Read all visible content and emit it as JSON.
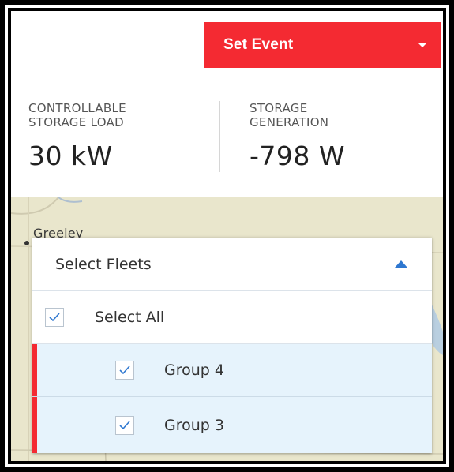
{
  "header": {
    "set_event_label": "Set Event",
    "set_event_color": "#f42a32"
  },
  "metrics": [
    {
      "label_line1": "CONTROLLABLE",
      "label_line2": "STORAGE LOAD",
      "value": "30 kW"
    },
    {
      "label_line1": "STORAGE",
      "label_line2": "GENERATION",
      "value": "-798 W"
    }
  ],
  "map": {
    "place_label": "Greeley"
  },
  "fleet_dropdown": {
    "title": "Select Fleets",
    "expanded": true,
    "select_all": {
      "label": "Select All",
      "checked": true
    },
    "items": [
      {
        "label": "Group 4",
        "checked": true,
        "selected": true
      },
      {
        "label": "Group 3",
        "checked": true,
        "selected": true
      }
    ],
    "accent_color": "#2e77d0",
    "selected_row_color": "#e6f3fc"
  },
  "icons": {
    "dropdown_caret": "chevron-down-icon",
    "collapse_caret": "chevron-up-icon",
    "check": "check-icon"
  }
}
